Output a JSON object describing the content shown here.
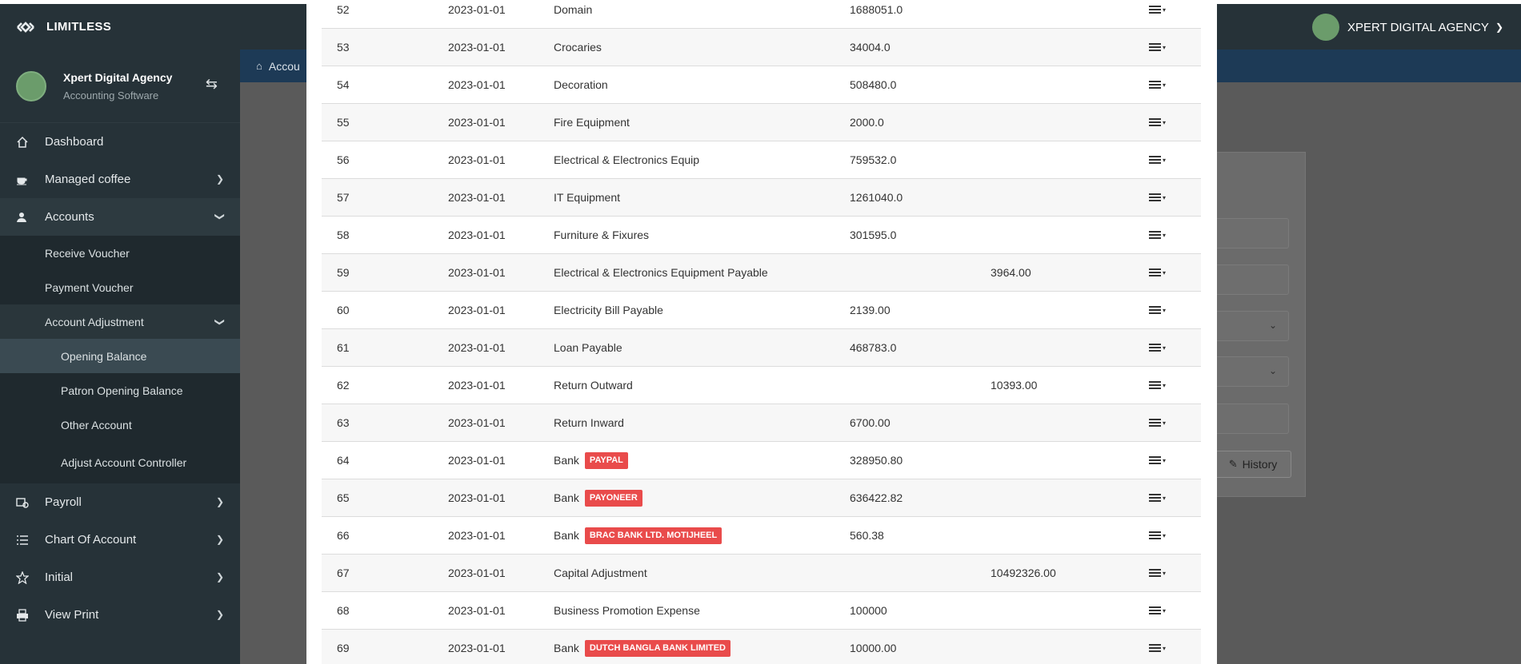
{
  "brand": {
    "name": "LIMITLESS",
    "logo_icon": "limitless-logo-icon"
  },
  "user_menu": {
    "name": "XPERT DIGITAL AGENCY"
  },
  "sidebar": {
    "user": {
      "name": "Xpert Digital Agency",
      "subtitle": "Accounting Software"
    },
    "items": [
      {
        "label": "Dashboard",
        "icon": "home-icon"
      },
      {
        "label": "Managed coffee",
        "icon": "coffee-icon"
      },
      {
        "label": "Accounts",
        "icon": "accounts-icon"
      }
    ],
    "accounts_sub": [
      {
        "label": "Receive Voucher"
      },
      {
        "label": "Payment Voucher"
      },
      {
        "label": "Account Adjustment"
      }
    ],
    "adjustment_sub": [
      {
        "label": "Opening Balance"
      },
      {
        "label": "Patron Opening Balance"
      },
      {
        "label": "Other Account"
      },
      {
        "label": "Adjust Account Controller"
      }
    ],
    "bottom_items": [
      {
        "label": "Payroll",
        "icon": "payroll-icon"
      },
      {
        "label": "Chart Of Account",
        "icon": "list-icon"
      },
      {
        "label": "Initial",
        "icon": "star-icon"
      },
      {
        "label": "View Print",
        "icon": "print-icon"
      }
    ]
  },
  "breadcrumb": {
    "text": "Accou"
  },
  "history_button": {
    "label": "History"
  },
  "rows": [
    {
      "id": "52",
      "date": "2023-01-01",
      "name": "Domain",
      "badge": "",
      "debit": "1688051.0",
      "credit": ""
    },
    {
      "id": "53",
      "date": "2023-01-01",
      "name": "Crocaries",
      "badge": "",
      "debit": "34004.0",
      "credit": ""
    },
    {
      "id": "54",
      "date": "2023-01-01",
      "name": "Decoration",
      "badge": "",
      "debit": "508480.0",
      "credit": ""
    },
    {
      "id": "55",
      "date": "2023-01-01",
      "name": "Fire Equipment",
      "badge": "",
      "debit": "2000.0",
      "credit": ""
    },
    {
      "id": "56",
      "date": "2023-01-01",
      "name": "Electrical & Electronics Equip",
      "badge": "",
      "debit": "759532.0",
      "credit": ""
    },
    {
      "id": "57",
      "date": "2023-01-01",
      "name": "IT Equipment",
      "badge": "",
      "debit": "1261040.0",
      "credit": ""
    },
    {
      "id": "58",
      "date": "2023-01-01",
      "name": "Furniture & Fixures",
      "badge": "",
      "debit": "301595.0",
      "credit": ""
    },
    {
      "id": "59",
      "date": "2023-01-01",
      "name": "Electrical & Electronics Equipment Payable",
      "badge": "",
      "debit": "",
      "credit": "3964.00"
    },
    {
      "id": "60",
      "date": "2023-01-01",
      "name": "Electricity Bill Payable",
      "badge": "",
      "debit": "2139.00",
      "credit": ""
    },
    {
      "id": "61",
      "date": "2023-01-01",
      "name": "Loan Payable",
      "badge": "",
      "debit": "468783.0",
      "credit": ""
    },
    {
      "id": "62",
      "date": "2023-01-01",
      "name": "Return Outward",
      "badge": "",
      "debit": "",
      "credit": "10393.00"
    },
    {
      "id": "63",
      "date": "2023-01-01",
      "name": "Return Inward",
      "badge": "",
      "debit": "6700.00",
      "credit": ""
    },
    {
      "id": "64",
      "date": "2023-01-01",
      "name": "Bank",
      "badge": "PAYPAL",
      "debit": "328950.80",
      "credit": ""
    },
    {
      "id": "65",
      "date": "2023-01-01",
      "name": "Bank",
      "badge": "PAYONEER",
      "debit": "636422.82",
      "credit": ""
    },
    {
      "id": "66",
      "date": "2023-01-01",
      "name": "Bank",
      "badge": "BRAC BANK LTD. MOTIJHEEL",
      "debit": "560.38",
      "credit": ""
    },
    {
      "id": "67",
      "date": "2023-01-01",
      "name": "Capital Adjustment",
      "badge": "",
      "debit": "",
      "credit": "10492326.00"
    },
    {
      "id": "68",
      "date": "2023-01-01",
      "name": "Business Promotion Expense",
      "badge": "",
      "debit": "100000",
      "credit": ""
    },
    {
      "id": "69",
      "date": "2023-01-01",
      "name": "Bank",
      "badge": "DUTCH BANGLA BANK LIMITED",
      "debit": "10000.00",
      "credit": ""
    }
  ],
  "colors": {
    "sidebar_bg": "#263238",
    "header_bg": "#1d3a56",
    "badge_red": "#e94b4b",
    "active_item": "#3a4a52"
  }
}
